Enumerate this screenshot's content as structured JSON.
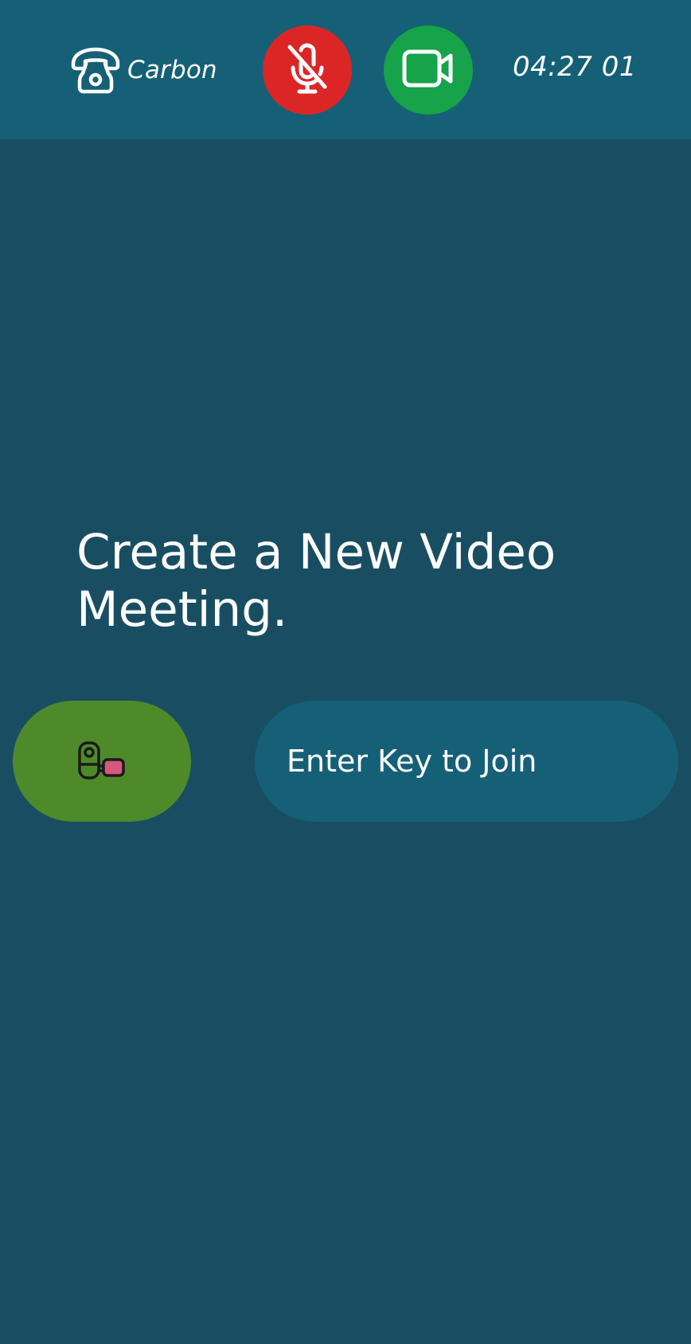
{
  "app": {
    "brand_name": "Carbon",
    "brand_icon": "telephone-icon"
  },
  "controls": {
    "mic": {
      "icon": "microphone-off-icon",
      "state": "muted",
      "color": "#dc2626"
    },
    "camera": {
      "icon": "video-camera-icon",
      "state": "on",
      "color": "#16a34a"
    }
  },
  "clock": {
    "time": "04:27 01"
  },
  "main": {
    "heading": "Create a New Video Meeting.",
    "new_meeting_button": {
      "icon": "camcorder-icon",
      "color": "#4f8a2a"
    },
    "join_input": {
      "placeholder": "Enter Key to Join"
    }
  },
  "colors": {
    "background": "#194e62",
    "topbar": "#156076",
    "input_background": "#156076",
    "camcorder_lens": "#d6587a"
  }
}
